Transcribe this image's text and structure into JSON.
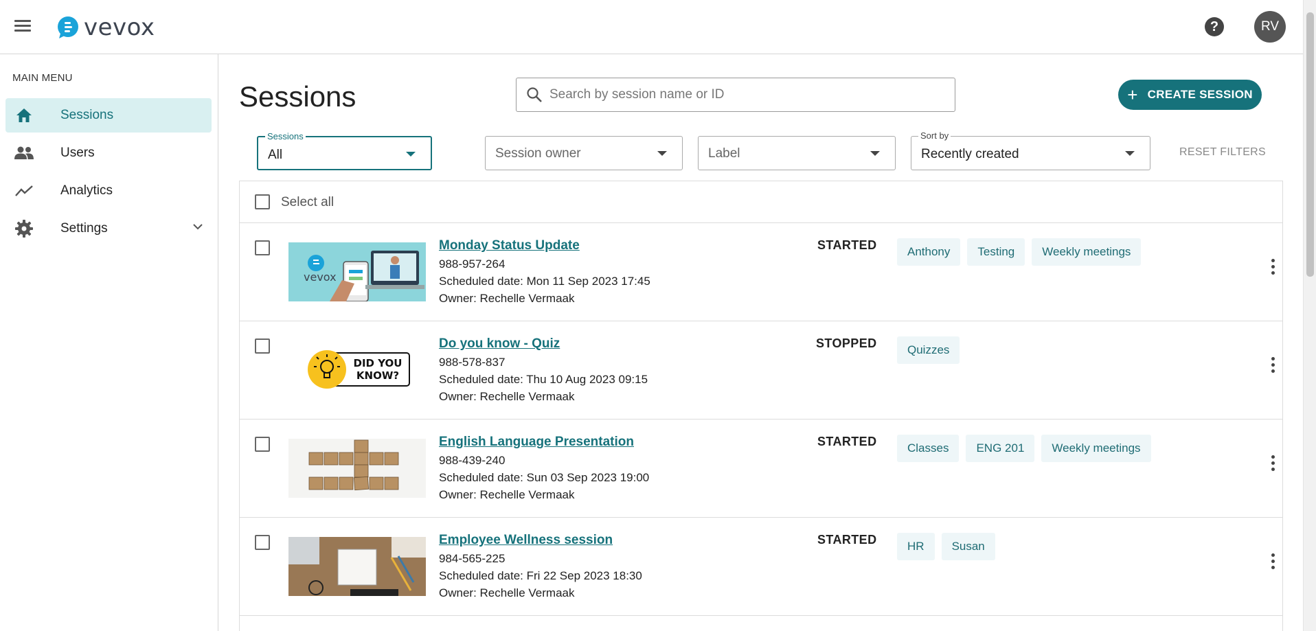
{
  "app": {
    "logo_text": "vevox",
    "user_initials": "RV"
  },
  "sidebar": {
    "menu_label": "MAIN MENU",
    "items": [
      {
        "label": "Sessions",
        "icon": "home-icon",
        "active": true
      },
      {
        "label": "Users",
        "icon": "users-icon"
      },
      {
        "label": "Analytics",
        "icon": "analytics-icon"
      },
      {
        "label": "Settings",
        "icon": "gear-icon"
      }
    ]
  },
  "main": {
    "title": "Sessions",
    "search_placeholder": "Search by session name or ID",
    "create_label": "CREATE SESSION",
    "reset_label": "RESET FILTERS",
    "select_all_label": "Select all"
  },
  "filters": {
    "sessions": {
      "label": "Sessions",
      "value": "All"
    },
    "owner": {
      "placeholder": "Session owner"
    },
    "label": {
      "placeholder": "Label"
    },
    "sort": {
      "label": "Sort by",
      "value": "Recently created"
    }
  },
  "sessions": [
    {
      "name": "Monday Status Update",
      "id": "988-957-264",
      "scheduled": "Scheduled date: Mon 11 Sep 2023 17:45",
      "owner": "Owner: Rechelle Vermaak",
      "status": "STARTED",
      "tags": [
        "Anthony",
        "Testing",
        "Weekly meetings"
      ]
    },
    {
      "name": "Do you know - Quiz",
      "id": "988-578-837",
      "scheduled": "Scheduled date: Thu 10 Aug 2023 09:15",
      "owner": "Owner: Rechelle Vermaak",
      "status": "STOPPED",
      "tags": [
        "Quizzes"
      ],
      "thumb_text": [
        "DID YOU",
        "KNOW?"
      ]
    },
    {
      "name": "English Language Presentation",
      "id": "988-439-240",
      "scheduled": "Scheduled date: Sun 03 Sep 2023 19:00",
      "owner": "Owner: Rechelle Vermaak",
      "status": "STARTED",
      "tags": [
        "Classes",
        "ENG 201",
        "Weekly meetings"
      ]
    },
    {
      "name": "Employee Wellness session",
      "id": "984-565-225",
      "scheduled": "Scheduled date: Fri 22 Sep 2023 18:30",
      "owner": "Owner: Rechelle Vermaak",
      "status": "STARTED",
      "tags": [
        "HR",
        "Susan"
      ]
    }
  ],
  "colors": {
    "accent": "#16727b",
    "active_bg": "#d9f0f1",
    "tag_bg": "#eef6f8"
  }
}
